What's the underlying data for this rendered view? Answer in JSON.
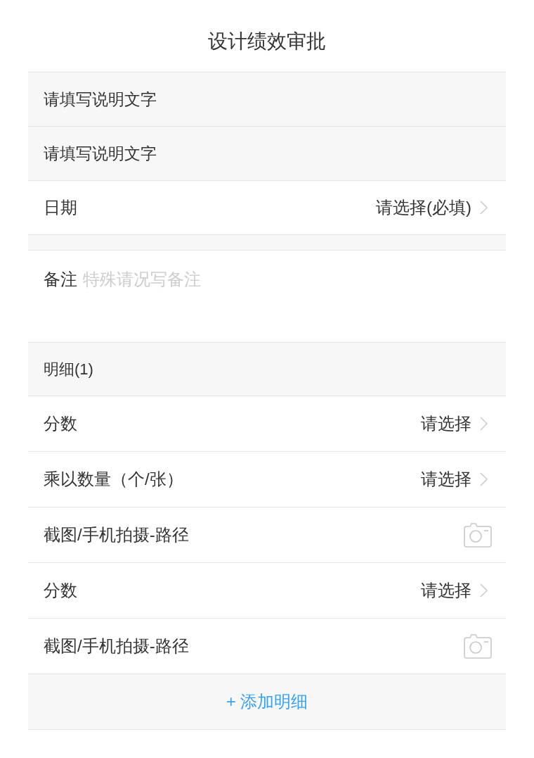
{
  "title": "设计绩效审批",
  "notes": [
    {
      "text": "请填写说明文字"
    },
    {
      "text": "请填写说明文字"
    }
  ],
  "date_field": {
    "label": "日期",
    "value": "请选择(必填)"
  },
  "remark_field": {
    "label": "备注",
    "placeholder": "特殊请况写备注"
  },
  "detail_section": {
    "title": "明细(1)",
    "rows": [
      {
        "kind": "select",
        "label": "分数",
        "value": "请选择"
      },
      {
        "kind": "select",
        "label": "乘以数量（个/张）",
        "value": "请选择"
      },
      {
        "kind": "photo",
        "label": "截图/手机拍摄-路径"
      },
      {
        "kind": "select",
        "label": "分数",
        "value": "请选择"
      },
      {
        "kind": "photo",
        "label": "截图/手机拍摄-路径"
      }
    ]
  },
  "add_button": {
    "label": "+ 添加明细"
  }
}
